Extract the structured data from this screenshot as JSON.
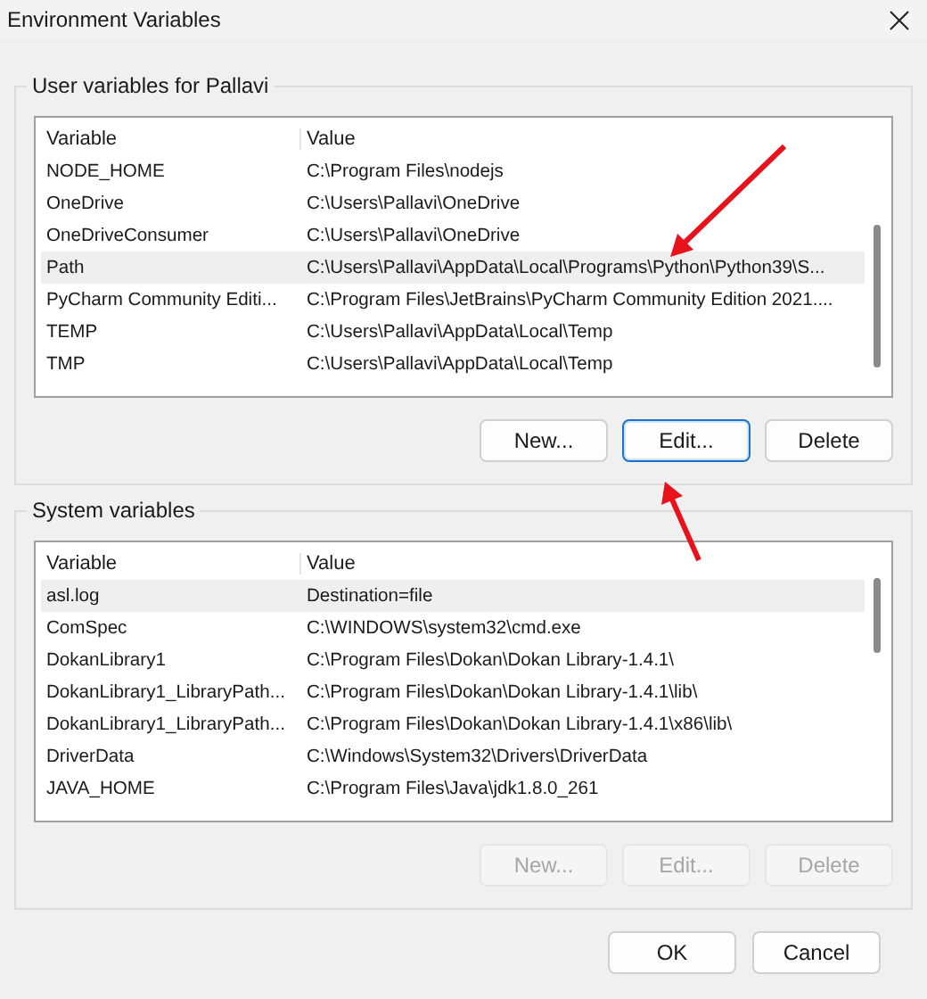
{
  "window": {
    "title": "Environment Variables"
  },
  "groups": [
    {
      "title": "User variables for Pallavi",
      "columns": [
        "Variable",
        "Value"
      ],
      "rows": [
        {
          "variable": "NODE_HOME",
          "value": "C:\\Program Files\\nodejs",
          "selected": false
        },
        {
          "variable": "OneDrive",
          "value": "C:\\Users\\Pallavi\\OneDrive",
          "selected": false
        },
        {
          "variable": "OneDriveConsumer",
          "value": "C:\\Users\\Pallavi\\OneDrive",
          "selected": false
        },
        {
          "variable": "Path",
          "value": "C:\\Users\\Pallavi\\AppData\\Local\\Programs\\Python\\Python39\\S...",
          "selected": true
        },
        {
          "variable": "PyCharm Community Editi...",
          "value": "C:\\Program Files\\JetBrains\\PyCharm Community Edition 2021....",
          "selected": false
        },
        {
          "variable": "TEMP",
          "value": "C:\\Users\\Pallavi\\AppData\\Local\\Temp",
          "selected": false
        },
        {
          "variable": "TMP",
          "value": "C:\\Users\\Pallavi\\AppData\\Local\\Temp",
          "selected": false
        }
      ],
      "buttons": [
        {
          "label": "New...",
          "disabled": false,
          "focused": false
        },
        {
          "label": "Edit...",
          "disabled": false,
          "focused": true
        },
        {
          "label": "Delete",
          "disabled": false,
          "focused": false
        }
      ]
    },
    {
      "title": "System variables",
      "columns": [
        "Variable",
        "Value"
      ],
      "rows": [
        {
          "variable": "asl.log",
          "value": "Destination=file",
          "selected": true
        },
        {
          "variable": "ComSpec",
          "value": "C:\\WINDOWS\\system32\\cmd.exe",
          "selected": false
        },
        {
          "variable": "DokanLibrary1",
          "value": "C:\\Program Files\\Dokan\\Dokan Library-1.4.1\\",
          "selected": false
        },
        {
          "variable": "DokanLibrary1_LibraryPath...",
          "value": "C:\\Program Files\\Dokan\\Dokan Library-1.4.1\\lib\\",
          "selected": false
        },
        {
          "variable": "DokanLibrary1_LibraryPath...",
          "value": "C:\\Program Files\\Dokan\\Dokan Library-1.4.1\\x86\\lib\\",
          "selected": false
        },
        {
          "variable": "DriverData",
          "value": "C:\\Windows\\System32\\Drivers\\DriverData",
          "selected": false
        },
        {
          "variable": "JAVA_HOME",
          "value": "C:\\Program Files\\Java\\jdk1.8.0_261",
          "selected": false
        }
      ],
      "buttons": [
        {
          "label": "New...",
          "disabled": true,
          "focused": false
        },
        {
          "label": "Edit...",
          "disabled": true,
          "focused": false
        },
        {
          "label": "Delete",
          "disabled": true,
          "focused": false
        }
      ]
    }
  ],
  "footer_buttons": [
    {
      "label": "OK"
    },
    {
      "label": "Cancel"
    }
  ]
}
